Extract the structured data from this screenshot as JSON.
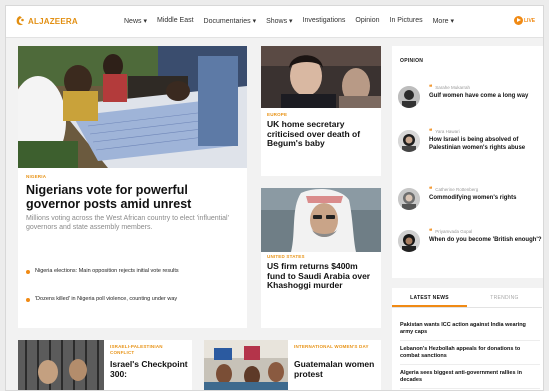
{
  "header": {
    "logo_text": "ALJAZEERA",
    "nav": [
      "News ▾",
      "Middle East",
      "Documentaries ▾",
      "Shows ▾",
      "Investigations",
      "Opinion",
      "In Pictures",
      "More ▾"
    ],
    "live_label": "LIVE"
  },
  "main_story": {
    "kicker": "NIGERIA",
    "headline": "Nigerians vote for powerful governor posts amid unrest",
    "summary": "Millions voting across the West African country to elect 'influential' governors and state assembly members.",
    "related": [
      "Nigeria elections: Main opposition rejects initial vote results",
      "'Dozens killed' in Nigeria poll violence, counting under way"
    ]
  },
  "stories": [
    {
      "kicker": "EUROPE",
      "headline": "UK home secretary criticised over death of Begum's baby"
    },
    {
      "kicker": "UNITED STATES",
      "headline": "US firm returns $400m fund to Saudi Arabia over Khashoggi murder"
    },
    {
      "kicker": "ISRAELI-PALESTINIAN CONFLICT",
      "headline": "Israel's Checkpoint 300:"
    },
    {
      "kicker": "INTERNATIONAL WOMEN'S DAY",
      "headline": "Guatemalan women protest"
    }
  ],
  "opinion": {
    "title": "OPINION",
    "items": [
      {
        "author": "Sarahe Mukarrah",
        "headline": "Gulf women have come a long way"
      },
      {
        "author": "Yara Hawari",
        "headline": "How Israel is being absolved of Palestinian women's rights abuse"
      },
      {
        "author": "Catherine Rottenberg",
        "headline": "Commodifying women's rights"
      },
      {
        "author": "Priyamvada Gopal",
        "headline": "When do you become 'British enough'?"
      }
    ]
  },
  "latest": {
    "tabs": [
      "LATEST NEWS",
      "TRENDING"
    ],
    "items": [
      "Pakistan wants ICC action against India wearing army caps",
      "Lebanon's Hezbollah appeals for donations to combat sanctions",
      "Algeria sees biggest anti-government rallies in decades"
    ]
  },
  "colors": {
    "accent": "#f08a14",
    "logo": "#e28f12"
  }
}
